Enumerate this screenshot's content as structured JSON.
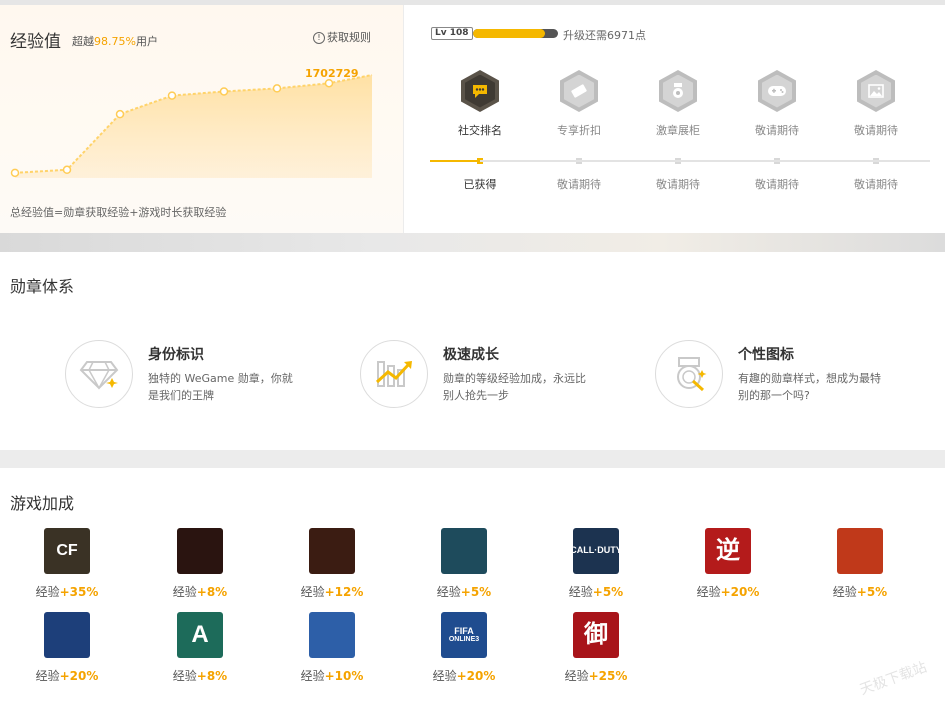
{
  "experience": {
    "title": "经验值",
    "surpass_prefix": "超越",
    "surpass_value": "98.75%",
    "surpass_suffix": "用户",
    "rules_link": "获取规则",
    "current_value": "1702729",
    "footer": "总经验值=勋章获取经验+游戏时长获取经验",
    "trend": [
      0.05,
      0.08,
      0.62,
      0.8,
      0.84,
      0.87,
      0.92,
      1.0
    ]
  },
  "level": {
    "badge": "Lv 108",
    "progress": 0.85,
    "upgrade_text": "升级还需6971点",
    "perks": [
      {
        "label": "社交排名",
        "icon": "chat-bubble",
        "status": "已获得",
        "active": true
      },
      {
        "label": "专享折扣",
        "icon": "ticket",
        "status": "敬请期待",
        "active": false
      },
      {
        "label": "激章展柜",
        "icon": "medal",
        "status": "敬请期待",
        "active": false
      },
      {
        "label": "敬请期待",
        "icon": "gamepad",
        "status": "敬请期待",
        "active": false
      },
      {
        "label": "敬请期待",
        "icon": "picture",
        "status": "敬请期待",
        "active": false
      }
    ]
  },
  "medal_system": {
    "title": "勋章体系",
    "features": [
      {
        "title": "身份标识",
        "desc": "独特的 WeGame 勋章，你就是我们的王牌",
        "icon": "diamond"
      },
      {
        "title": "极速成长",
        "desc": "勋章的等级经验加成，永远比别人抢先一步",
        "icon": "growth-chart"
      },
      {
        "title": "个性图标",
        "desc": "有趣的勋章样式，想成为最特别的那一个吗?",
        "icon": "badge-magic"
      }
    ]
  },
  "game_bonus": {
    "title": "游戏加成",
    "label": "经验",
    "games": [
      {
        "bonus": "+35%",
        "icon_text": "CF",
        "color": "#3a3225"
      },
      {
        "bonus": "+8%",
        "icon_text": "",
        "color": "#2a1410"
      },
      {
        "bonus": "+12%",
        "icon_text": "",
        "color": "#3b1c12"
      },
      {
        "bonus": "+5%",
        "icon_text": "",
        "color": "#1e4b5c"
      },
      {
        "bonus": "+5%",
        "icon_text": "CALL·DUTY",
        "color": "#1c3350"
      },
      {
        "bonus": "+20%",
        "icon_text": "逆",
        "color": "#b41b1b"
      },
      {
        "bonus": "+5%",
        "icon_text": "",
        "color": "#c0391a"
      },
      {
        "bonus": "+20%",
        "icon_text": "",
        "color": "#1d3f7a"
      },
      {
        "bonus": "+8%",
        "icon_text": "A",
        "color": "#1d6b5a"
      },
      {
        "bonus": "+10%",
        "icon_text": "",
        "color": "#2d5fa8"
      },
      {
        "bonus": "+20%",
        "icon_text": "FIFA",
        "sub_text": "ONLINE3",
        "color": "#1f4c8f"
      },
      {
        "bonus": "+25%",
        "icon_text": "御",
        "color": "#a8141a"
      }
    ]
  },
  "watermark": "天极下载站"
}
